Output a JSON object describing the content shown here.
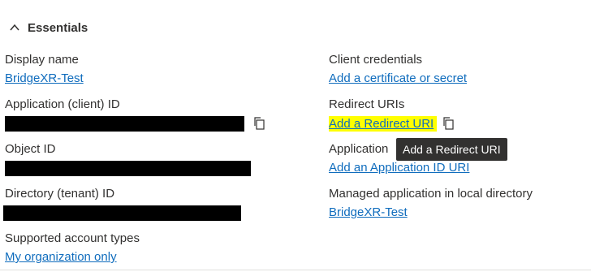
{
  "essentials": {
    "title": "Essentials",
    "toggle_icon": "chevron-up-icon"
  },
  "left": {
    "display_name": {
      "label": "Display name",
      "value": "BridgeXR-Test"
    },
    "application_client_id": {
      "label": "Application (client) ID",
      "value_redacted": true
    },
    "object_id": {
      "label": "Object ID",
      "value_redacted": true
    },
    "directory_tenant_id": {
      "label": "Directory (tenant) ID",
      "value_redacted": true
    },
    "supported_account_types": {
      "label": "Supported account types",
      "value": "My organization only"
    }
  },
  "right": {
    "client_credentials": {
      "label": "Client credentials",
      "value": "Add a certificate or secret"
    },
    "redirect_uris": {
      "label": "Redirect URIs",
      "value": "Add a Redirect URI",
      "highlight_color": "#ffff00"
    },
    "application_id_uri": {
      "label": "Application",
      "value": "Add an Application ID URI"
    },
    "managed_application": {
      "label": "Managed application in local directory",
      "value": "BridgeXR-Test"
    }
  },
  "tooltip": {
    "text": "Add a Redirect URI"
  },
  "icons": {
    "copy": "copy-icon"
  },
  "colors": {
    "link": "#0f6cbd",
    "text": "#323130",
    "redaction": "#000000",
    "tooltip_bg": "#323130",
    "highlight": "#ffff00"
  }
}
